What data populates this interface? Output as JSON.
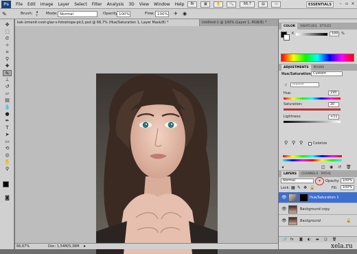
{
  "app": {
    "logo": "Ps",
    "workspace": "ESSENTIALS",
    "zoom_box": "66,7"
  },
  "menu": {
    "items": [
      "File",
      "Edit",
      "Image",
      "Layer",
      "Select",
      "Filter",
      "Analysis",
      "3D",
      "View",
      "Window",
      "Help"
    ]
  },
  "options": {
    "brush_label": "Brush:",
    "brush_size": "7",
    "mode_label": "Mode:",
    "mode_value": "Normal",
    "opacity_label": "Opacity:",
    "opacity_value": "100%",
    "flow_label": "Flow:",
    "flow_value": "100%"
  },
  "tabs": [
    {
      "label": "kak-izmenit-cvet-glaz-v-fotoshope-pic1.psd @ 66,7% (Hue/Saturation 1, Layer Mask/8) *",
      "active": true
    },
    {
      "label": "Untitled-1 @ 100% (Layer 1, RGB/8) *",
      "active": false
    }
  ],
  "photo": {
    "watermark": "xela.ru"
  },
  "status": {
    "zoom": "66,67%",
    "doc": "Doc: 1,54M/5,38M"
  },
  "color_panel": {
    "tabs": [
      "COLOR",
      "SWATCHES",
      "STYLES"
    ],
    "channel_label": "K",
    "value": "100",
    "unit": "%"
  },
  "adjustments": {
    "tabs": [
      "ADJUSTMENTS",
      "MASKS"
    ],
    "title": "Hue/Saturation",
    "preset": "Custom",
    "channel": "Master",
    "hue_label": "Hue:",
    "hue_value": "190",
    "saturation_label": "Saturation:",
    "saturation_value": "20",
    "lightness_label": "Lightness:",
    "lightness_value": "+11",
    "colorize_label": "Colorize"
  },
  "layers_panel": {
    "tabs": [
      "LAYERS",
      "CHANNELS",
      "PATHS"
    ],
    "blend_mode": "Normal",
    "opacity_label": "Opacity:",
    "opacity_value": "100%",
    "lock_label": "Lock:",
    "fill_label": "Fill:",
    "fill_value": "100%",
    "layers": [
      {
        "name": "Hue/Saturation 1",
        "selected": true
      },
      {
        "name": "Background copy",
        "selected": false
      },
      {
        "name": "Background",
        "selected": false
      }
    ]
  },
  "footer_watermark": "xela.ru",
  "colors": {
    "accent": "#3a74c9",
    "selected_layer": "#3d6fd1",
    "canvas_bg": "#bdbdbd"
  }
}
